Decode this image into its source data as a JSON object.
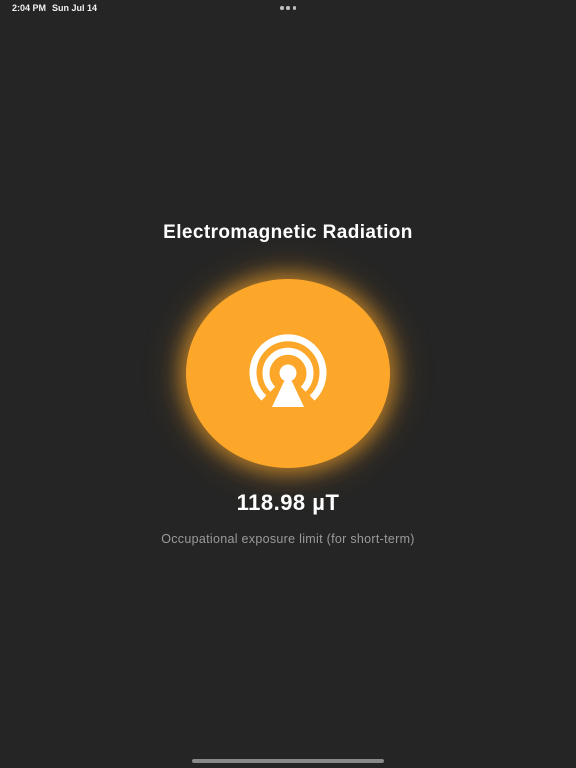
{
  "status_bar": {
    "time": "2:04 PM",
    "date": "Sun Jul 14",
    "multitask_icon": "ellipsis-icon"
  },
  "main": {
    "title": "Electromagnetic Radiation",
    "reading": "118.98 µT",
    "description": "Occupational exposure limit (for short-term)",
    "meter_icon": "broadcast-signal-icon",
    "accent_color": "#fda72a",
    "background_color": "#252525"
  }
}
